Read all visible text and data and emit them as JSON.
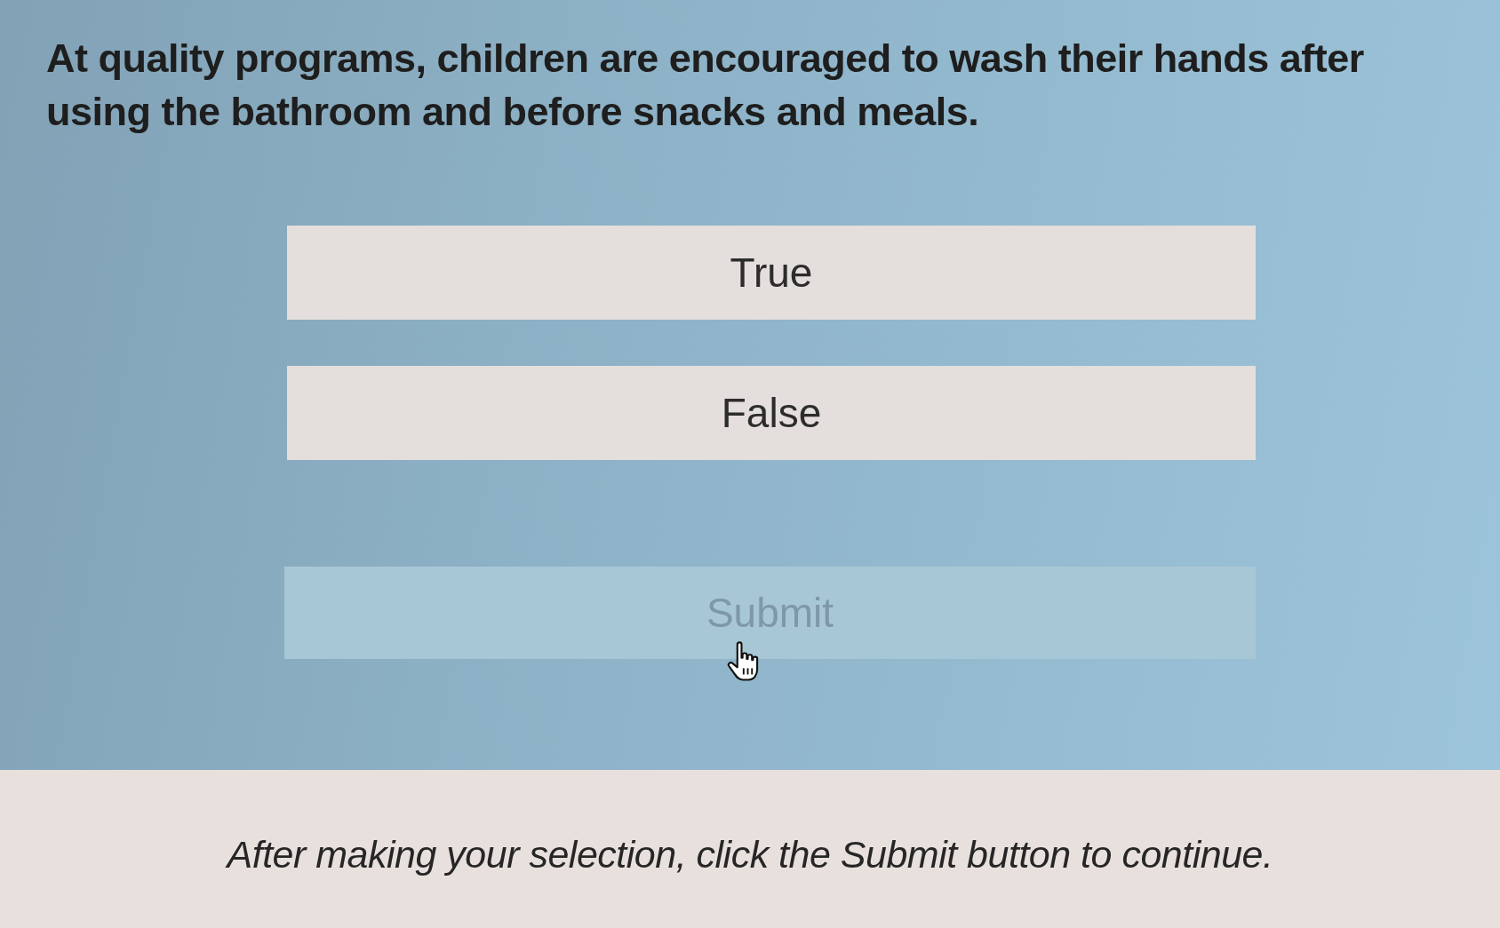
{
  "question": {
    "text": "At quality programs, children are encouraged to wash their hands after using the bathroom and before snacks and meals."
  },
  "options": [
    {
      "label": "True",
      "selected": false
    },
    {
      "label": "False",
      "selected": false
    }
  ],
  "submit_button": {
    "label": "Submit",
    "disabled": true
  },
  "instruction": {
    "text": "After making your selection, click the Submit button to continue."
  }
}
